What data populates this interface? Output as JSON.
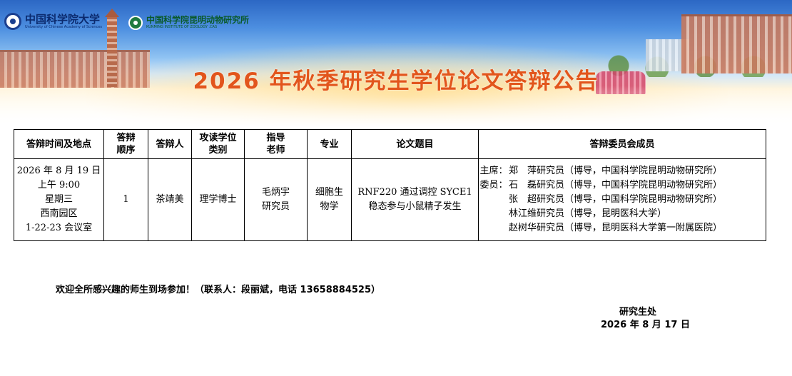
{
  "header": {
    "logo_cas_cn": "中国科学院大学",
    "logo_cas_en": "University of Chinese Academy of Sciences",
    "logo_kiz_cn": "中国科学院昆明动物研究所",
    "logo_kiz_en": "KUNMING INSTITUTE OF ZOOLOGY .CAS",
    "title": "2026 年秋季研究生学位论文答辩公告"
  },
  "table": {
    "headers": {
      "time_place": "答辩时间及地点",
      "order_1": "答辩",
      "order_2": "顺序",
      "candidate": "答辩人",
      "degree_1": "攻读学位",
      "degree_2": "类别",
      "advisor_1": "指导",
      "advisor_2": "老师",
      "major": "专业",
      "thesis": "论文题目",
      "committee": "答辩委员会成员"
    },
    "row": {
      "date": "2026 年 8 月 19 日",
      "time": "上午 9:00",
      "weekday": "星期三",
      "campus": "西南园区",
      "room": "1-22-23 会议室",
      "order": "1",
      "candidate": "茶靖美",
      "degree": "理学博士",
      "advisor_name": "毛炳宇",
      "advisor_title": "研究员",
      "major_1": "细胞生",
      "major_2": "物学",
      "thesis_1": "RNF220 通过调控 SYCE1",
      "thesis_2": "稳态参与小鼠精子发生",
      "committee": [
        {
          "role": "主席：",
          "text": "郑　萍研究员（博导，中国科学院昆明动物研究所）"
        },
        {
          "role": "委员：",
          "text": "石　磊研究员（博导，中国科学院昆明动物研究所）"
        },
        {
          "role": "",
          "text": "张　超研究员（博导，中国科学院昆明动物研究所）"
        },
        {
          "role": "",
          "text": "林江维研究员（博导，昆明医科大学）"
        },
        {
          "role": "",
          "text": "赵树华研究员（博导，昆明医科大学第一附属医院）"
        }
      ]
    }
  },
  "footer": {
    "welcome": "欢迎全所感兴趣的师生到场参加！（联系人：段丽斌，电话 13658884525）",
    "signature_org": "研究生处",
    "signature_date": "2026 年 8 月 17 日"
  },
  "colors": {
    "title": "#e2551c",
    "banner_sky": "#2c67c4",
    "border": "#000000"
  }
}
